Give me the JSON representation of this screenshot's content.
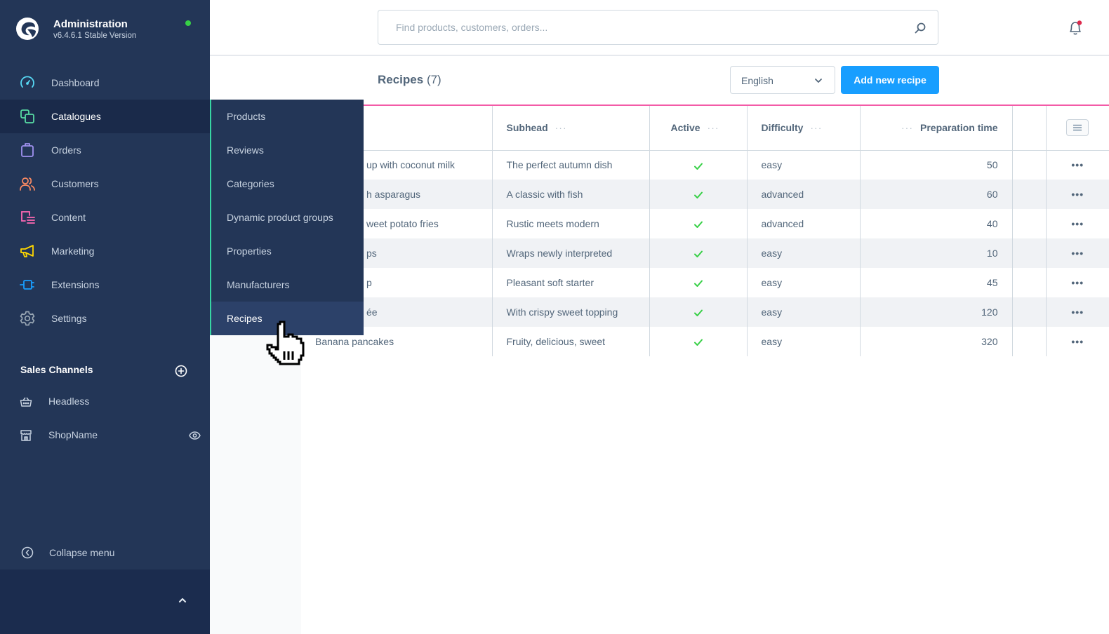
{
  "brand": {
    "title": "Administration",
    "version": "v6.4.6.1 Stable Version",
    "status_color": "#37d046"
  },
  "nav": {
    "items": [
      {
        "label": "Dashboard",
        "icon": "dashboard-icon",
        "color": "#57d9f5"
      },
      {
        "label": "Catalogues",
        "icon": "catalogues-icon",
        "color": "#57d9a3",
        "active": true
      },
      {
        "label": "Orders",
        "icon": "orders-icon",
        "color": "#a092f0"
      },
      {
        "label": "Customers",
        "icon": "customers-icon",
        "color": "#f88962"
      },
      {
        "label": "Content",
        "icon": "content-icon",
        "color": "#ff68b4"
      },
      {
        "label": "Marketing",
        "icon": "marketing-icon",
        "color": "#ffd700"
      },
      {
        "label": "Extensions",
        "icon": "extensions-icon",
        "color": "#189eff"
      },
      {
        "label": "Settings",
        "icon": "settings-icon",
        "color": "#9aa8b5"
      }
    ]
  },
  "sales_channels": {
    "title": "Sales Channels",
    "items": [
      {
        "label": "Headless",
        "icon": "basket-icon"
      },
      {
        "label": "ShopName",
        "icon": "storefront-icon",
        "visibility_icon": "eye-icon"
      }
    ]
  },
  "collapse_menu_label": "Collapse menu",
  "submenu": {
    "items": [
      "Products",
      "Reviews",
      "Categories",
      "Dynamic product groups",
      "Properties",
      "Manufacturers",
      "Recipes"
    ],
    "hovered": "Recipes"
  },
  "search": {
    "placeholder": "Find products, customers, orders...",
    "value": ""
  },
  "notifications": {
    "has_unread": true
  },
  "page": {
    "title": "Recipes",
    "count": "(7)",
    "language": "English",
    "add_button": "Add new recipe"
  },
  "grid": {
    "columns": [
      "",
      "Subhead",
      "Active",
      "Difficulty",
      "Preparation time",
      ""
    ],
    "rows": [
      {
        "name": "up with coconut milk",
        "subhead": "The perfect autumn dish",
        "active": true,
        "difficulty": "easy",
        "prep_time": "50"
      },
      {
        "name": "h asparagus",
        "subhead": "A classic with fish",
        "active": true,
        "difficulty": "advanced",
        "prep_time": "60"
      },
      {
        "name": "weet potato fries",
        "subhead": "Rustic meets modern",
        "active": true,
        "difficulty": "advanced",
        "prep_time": "40"
      },
      {
        "name": "ps",
        "subhead": "Wraps newly interpreted",
        "active": true,
        "difficulty": "easy",
        "prep_time": "10"
      },
      {
        "name": "p",
        "subhead": "Pleasant soft starter",
        "active": true,
        "difficulty": "easy",
        "prep_time": "45"
      },
      {
        "name": "ée",
        "subhead": "With crispy sweet topping",
        "active": true,
        "difficulty": "easy",
        "prep_time": "120"
      },
      {
        "name": "Banana pancakes",
        "subhead": "Fruity, delicious, sweet",
        "active": true,
        "difficulty": "easy",
        "prep_time": "320"
      }
    ],
    "accent_color": "#f35ba7",
    "check_color": "#37d046"
  }
}
